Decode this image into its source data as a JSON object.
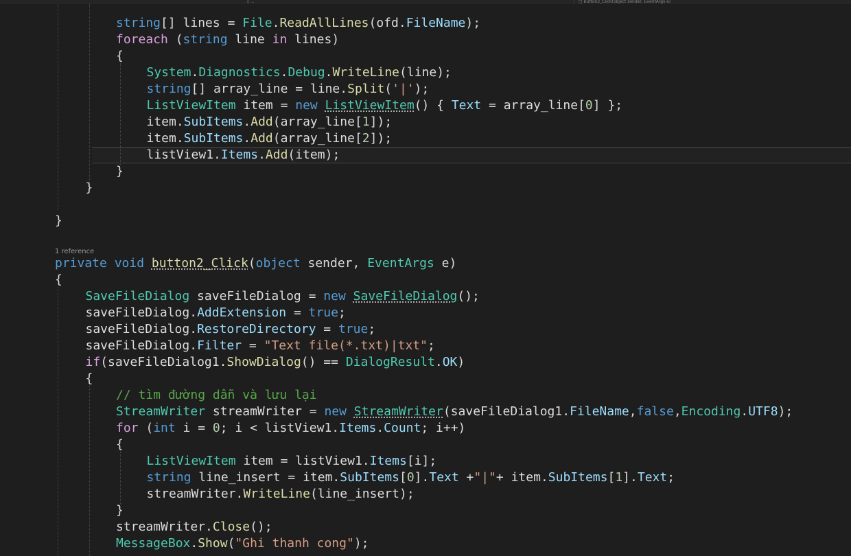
{
  "tabs": {
    "left_fragment": "◊ ...",
    "right_fragment": "□ button2_Click(object sender, EventArgs e)"
  },
  "theme": {
    "background": "#1e1e1e",
    "keyword": "#569cd6",
    "type": "#4ec9b0",
    "method": "#dcdcaa",
    "string": "#d69d85",
    "comment": "#57a64a"
  },
  "codelens": {
    "text": "1 reference"
  },
  "lines": [
    {
      "indent": 2,
      "code": "string[] lines = File.ReadAllLines(ofd.FileName);"
    },
    {
      "indent": 2,
      "code": "foreach (string line in lines)"
    },
    {
      "indent": 2,
      "code": "{"
    },
    {
      "indent": 3,
      "code": "System.Diagnostics.Debug.WriteLine(line);"
    },
    {
      "indent": 3,
      "code": "string[] array_line = line.Split('|');"
    },
    {
      "indent": 3,
      "code": "ListViewItem item = new ListViewItem() { Text = array_line[0] };"
    },
    {
      "indent": 3,
      "code": "item.SubItems.Add(array_line[1]);"
    },
    {
      "indent": 3,
      "code": "item.SubItems.Add(array_line[2]);"
    },
    {
      "indent": 3,
      "code": "listView1.Items.Add(item);"
    },
    {
      "indent": 2,
      "code": "}"
    },
    {
      "indent": 1,
      "code": "}"
    },
    {
      "indent": 0,
      "code": ""
    },
    {
      "indent": 0,
      "code": "}"
    },
    {
      "indent": 0,
      "code": "private void button2_Click(object sender, EventArgs e)"
    },
    {
      "indent": 0,
      "code": "{"
    },
    {
      "indent": 1,
      "code": "SaveFileDialog saveFileDialog = new SaveFileDialog();"
    },
    {
      "indent": 1,
      "code": "saveFileDialog.AddExtension = true;"
    },
    {
      "indent": 1,
      "code": "saveFileDialog.RestoreDirectory = true;"
    },
    {
      "indent": 1,
      "code": "saveFileDialog.Filter = \"Text file(*.txt)|txt\";"
    },
    {
      "indent": 1,
      "code": "if(saveFileDialog1.ShowDialog() == DialogResult.OK)"
    },
    {
      "indent": 1,
      "code": "{"
    },
    {
      "indent": 2,
      "code": "// tìm đường dẫn và lưu lại"
    },
    {
      "indent": 2,
      "code": "StreamWriter streamWriter = new StreamWriter(saveFileDialog1.FileName,false,Encoding.UTF8);"
    },
    {
      "indent": 2,
      "code": "for (int i = 0; i < listView1.Items.Count; i++)"
    },
    {
      "indent": 2,
      "code": "{"
    },
    {
      "indent": 3,
      "code": "ListViewItem item = listView1.Items[i];"
    },
    {
      "indent": 3,
      "code": "string line_insert = item.SubItems[0].Text +\"|\"+ item.SubItems[1].Text;"
    },
    {
      "indent": 3,
      "code": "streamWriter.WriteLine(line_insert);"
    },
    {
      "indent": 2,
      "code": "}"
    },
    {
      "indent": 2,
      "code": "streamWriter.Close();"
    },
    {
      "indent": 2,
      "code": "MessageBox.Show(\"Ghi thanh cong\");"
    }
  ]
}
